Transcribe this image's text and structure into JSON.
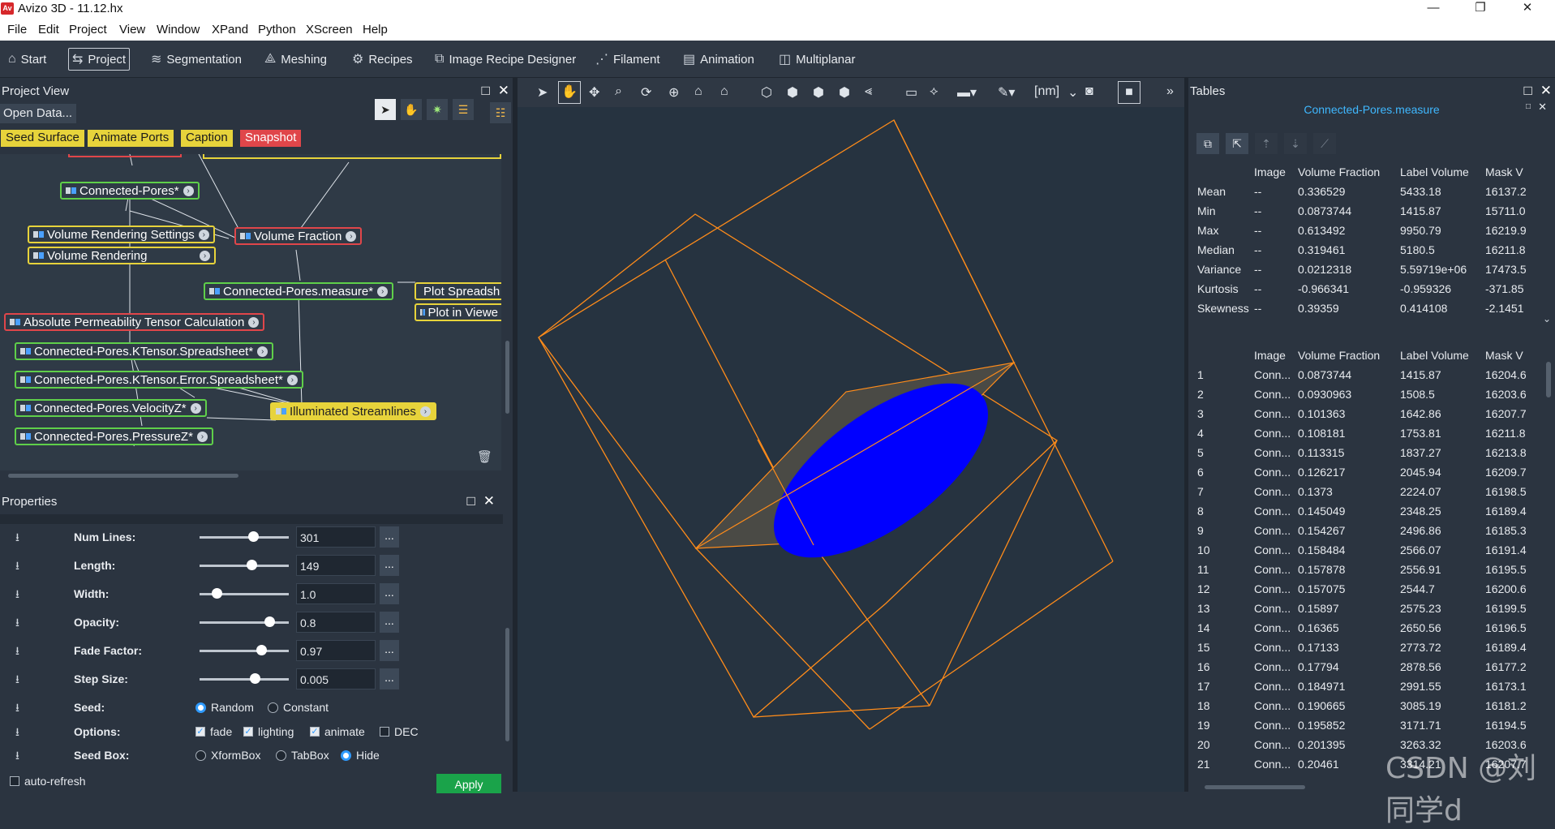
{
  "window": {
    "title": "Avizo 3D - 11.12.hx",
    "logo": "Av"
  },
  "menu": [
    "File",
    "Edit",
    "Project",
    "View",
    "Window",
    "XPand",
    "Python",
    "XScreen",
    "Help"
  ],
  "toolbar": [
    {
      "label": "Start",
      "icon": "home-icon"
    },
    {
      "label": "Project",
      "icon": "project-icon"
    },
    {
      "label": "Segmentation",
      "icon": "layers-icon"
    },
    {
      "label": "Meshing",
      "icon": "mesh-icon"
    },
    {
      "label": "Recipes",
      "icon": "gears-icon"
    },
    {
      "label": "Image Recipe Designer",
      "icon": "recipe-icon"
    },
    {
      "label": "Filament",
      "icon": "filament-icon"
    },
    {
      "label": "Animation",
      "icon": "film-icon"
    },
    {
      "label": "Multiplanar",
      "icon": "planes-icon"
    }
  ],
  "project_view": {
    "title": "Project View",
    "open_data": "Open Data...",
    "quick_buttons": [
      "Seed Surface",
      "Animate Ports",
      "Caption",
      "Snapshot"
    ],
    "nodes": [
      {
        "label": "Connected-Pores*",
        "color": "green"
      },
      {
        "label": "Volume Rendering Settings",
        "color": "yellow"
      },
      {
        "label": "Volume Rendering",
        "color": "yellow"
      },
      {
        "label": "Volume Fraction",
        "color": "red"
      },
      {
        "label": "Connected-Pores.measure*",
        "color": "green"
      },
      {
        "label": "Plot Spreadsh",
        "color": "yellow"
      },
      {
        "label": "Plot in Viewe",
        "color": "yellow"
      },
      {
        "label": "Absolute Permeability Tensor Calculation",
        "color": "red"
      },
      {
        "label": "Connected-Pores.KTensor.Spreadsheet*",
        "color": "green"
      },
      {
        "label": "Connected-Pores.KTensor.Error.Spreadsheet*",
        "color": "green"
      },
      {
        "label": "Connected-Pores.VelocityZ*",
        "color": "green"
      },
      {
        "label": "Illuminated Streamlines",
        "color": "yellow"
      },
      {
        "label": "Connected-Pores.PressureZ*",
        "color": "green"
      }
    ]
  },
  "properties": {
    "title": "Properties",
    "sliders": [
      {
        "label": "Num Lines:",
        "value": "301",
        "pos": 0.48
      },
      {
        "label": "Length:",
        "value": "149",
        "pos": 0.47
      },
      {
        "label": "Width:",
        "value": "1.0",
        "pos": 0.15
      },
      {
        "label": "Opacity:",
        "value": "0.8",
        "pos": 0.64
      },
      {
        "label": "Fade Factor:",
        "value": "0.97",
        "pos": 0.56
      },
      {
        "label": "Step Size:",
        "value": "0.005",
        "pos": 0.5
      }
    ],
    "seed": {
      "label": "Seed:",
      "options": [
        "Random",
        "Constant"
      ],
      "selected": "Random"
    },
    "options": {
      "label": "Options:",
      "items": [
        {
          "t": "fade",
          "on": true
        },
        {
          "t": "lighting",
          "on": true
        },
        {
          "t": "animate",
          "on": true
        },
        {
          "t": "DEC",
          "on": false
        }
      ]
    },
    "seedbox": {
      "label": "Seed Box:",
      "options": [
        "XformBox",
        "TabBox",
        "Hide"
      ],
      "selected": "Hide"
    },
    "auto_refresh": "auto-refresh",
    "apply": "Apply"
  },
  "viewer": {
    "unit": "[nm]"
  },
  "tables": {
    "title": "Tables",
    "tab": "Connected-Pores.measure",
    "columns": [
      "Image",
      "Volume Fraction",
      "Label Volume",
      "Mask V"
    ],
    "stats": [
      [
        "Mean",
        "--",
        "0.336529",
        "5433.18",
        "16137.2"
      ],
      [
        "Min",
        "--",
        "0.0873744",
        "1415.87",
        "15711.0"
      ],
      [
        "Max",
        "--",
        "0.613492",
        "9950.79",
        "16219.9"
      ],
      [
        "Median",
        "--",
        "0.319461",
        "5180.5",
        "16211.8"
      ],
      [
        "Variance",
        "--",
        "0.0212318",
        "5.59719e+06",
        "17473.5"
      ],
      [
        "Kurtosis",
        "--",
        "-0.966341",
        "-0.959326",
        "-371.85"
      ],
      [
        "Skewness",
        "--",
        "0.39359",
        "0.414108",
        "-2.1451"
      ]
    ],
    "rows": [
      [
        "1",
        "Conn...",
        "0.0873744",
        "1415.87",
        "16204.6"
      ],
      [
        "2",
        "Conn...",
        "0.0930963",
        "1508.5",
        "16203.6"
      ],
      [
        "3",
        "Conn...",
        "0.101363",
        "1642.86",
        "16207.7"
      ],
      [
        "4",
        "Conn...",
        "0.108181",
        "1753.81",
        "16211.8"
      ],
      [
        "5",
        "Conn...",
        "0.113315",
        "1837.27",
        "16213.8"
      ],
      [
        "6",
        "Conn...",
        "0.126217",
        "2045.94",
        "16209.7"
      ],
      [
        "7",
        "Conn...",
        "0.1373",
        "2224.07",
        "16198.5"
      ],
      [
        "8",
        "Conn...",
        "0.145049",
        "2348.25",
        "16189.4"
      ],
      [
        "9",
        "Conn...",
        "0.154267",
        "2496.86",
        "16185.3"
      ],
      [
        "10",
        "Conn...",
        "0.158484",
        "2566.07",
        "16191.4"
      ],
      [
        "11",
        "Conn...",
        "0.157878",
        "2556.91",
        "16195.5"
      ],
      [
        "12",
        "Conn...",
        "0.157075",
        "2544.7",
        "16200.6"
      ],
      [
        "13",
        "Conn...",
        "0.15897",
        "2575.23",
        "16199.5"
      ],
      [
        "14",
        "Conn...",
        "0.16365",
        "2650.56",
        "16196.5"
      ],
      [
        "15",
        "Conn...",
        "0.17133",
        "2773.72",
        "16189.4"
      ],
      [
        "16",
        "Conn...",
        "0.17794",
        "2878.56",
        "16177.2"
      ],
      [
        "17",
        "Conn...",
        "0.184971",
        "2991.55",
        "16173.1"
      ],
      [
        "18",
        "Conn...",
        "0.190665",
        "3085.19",
        "16181.2"
      ],
      [
        "19",
        "Conn...",
        "0.195852",
        "3171.71",
        "16194.5"
      ],
      [
        "20",
        "Conn...",
        "0.201395",
        "3263.32",
        "16203.6"
      ],
      [
        "21",
        "Conn...",
        "0.20461",
        "3314.21",
        "16207.7"
      ]
    ]
  },
  "watermark": "CSDN @刘同学d"
}
